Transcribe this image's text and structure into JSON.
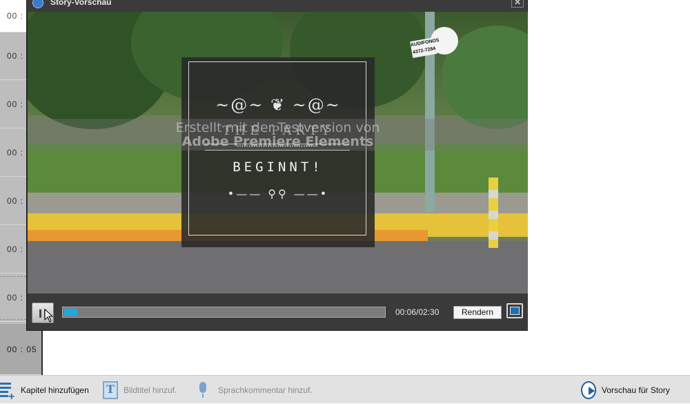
{
  "timeline": {
    "rows": [
      "00 :",
      "00 :",
      "00 :",
      "00 :",
      "00 :",
      "00 :",
      "00 :",
      "00 : 05"
    ]
  },
  "preview": {
    "title": "Story-Vorschau",
    "close_icon": "close-icon",
    "video": {
      "sign_text": "AUDIFONOS 4372-7284",
      "card": {
        "ornament_top": "~@~ ❦ ~@~",
        "party_text": "THE PARTY",
        "band_text": "••••••••••••••••••••••••••••••••••",
        "begin_text": "BEGINNT!",
        "ornament_bottom": "•—— ⚲⚲ ——•"
      },
      "watermark": {
        "line1": "Erstellt mit der Testversion von",
        "line2": "Adobe Premiere Elements"
      }
    },
    "controls": {
      "progress_fraction": 0.04,
      "time": "00:06/02:30",
      "render_label": "Rendern"
    }
  },
  "toolbar": {
    "chapter_label": "Kapitel hinzufügen",
    "title_label": "Bildtitel hinzuf.",
    "voice_label": "Sprachkommentar hinzuf.",
    "preview_label": "Vorschau für Story"
  },
  "colors": {
    "accent": "#1fa8e0",
    "icon_blue": "#1f5e9e"
  }
}
